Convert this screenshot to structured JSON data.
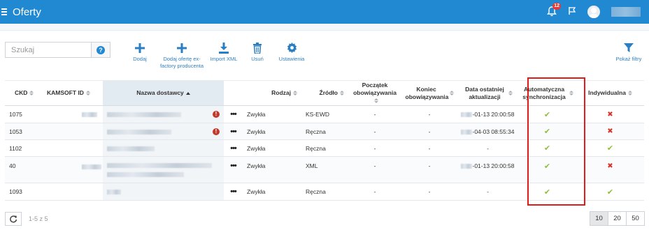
{
  "app": {
    "title": "Oferty",
    "notification_count": "12"
  },
  "search": {
    "placeholder": "Szukaj"
  },
  "toolbar": {
    "add": "Dodaj",
    "add_factory": "Dodaj ofertę ex-factory producenta",
    "import_xml": "Import XML",
    "delete": "Usuń",
    "settings": "Ustawienia",
    "show_filters": "Pokaż filtry"
  },
  "table": {
    "headers": {
      "ckd": "CKD",
      "kamsoft_id": "KAMSOFT ID",
      "supplier_name": "Nazwa dostawcy",
      "type": "Rodzaj",
      "source": "Źródło",
      "valid_from": "Początek obowiązywania",
      "valid_to": "Koniec obowiązywania",
      "last_update": "Data ostatniej aktualizacji",
      "auto_sync": "Automatyczna synchronizacja",
      "individual": "Indywidualna"
    },
    "rows": [
      {
        "ckd": "1075",
        "more": "•••",
        "type": "Zwykła",
        "source": "KS-EWD",
        "valid_from": "-",
        "valid_to": "-",
        "last_update": "-01-13 20:00:58",
        "auto_sync": "✔",
        "individual": "✖"
      },
      {
        "ckd": "1053",
        "more": "•••",
        "type": "Zwykła",
        "source": "Ręczna",
        "valid_from": "-",
        "valid_to": "-",
        "last_update": "-04-03 08:55:34",
        "auto_sync": "✔",
        "individual": "✖"
      },
      {
        "ckd": "1102",
        "more": "•••",
        "type": "Zwykła",
        "source": "Ręczna",
        "valid_from": "-",
        "valid_to": "-",
        "last_update": "-",
        "auto_sync": "✔",
        "individual": "✔"
      },
      {
        "ckd": "40",
        "more": "•••",
        "type": "Zwykła",
        "source": "XML",
        "valid_from": "-",
        "valid_to": "-",
        "last_update": "-01-13 20:00:58",
        "auto_sync": "✔",
        "individual": "✖"
      },
      {
        "ckd": "1093",
        "more": "•••",
        "type": "Zwykła",
        "source": "Ręczna",
        "valid_from": "-",
        "valid_to": "-",
        "last_update": "-",
        "auto_sync": "✔",
        "individual": "✔"
      }
    ]
  },
  "footer": {
    "pager_info": "1-5 z 5",
    "page_sizes": [
      "10",
      "20",
      "50"
    ],
    "active_page_size": "10"
  },
  "colors": {
    "primary": "#2189d2",
    "ok": "#8dbf3a",
    "error": "#d9332b",
    "highlight": "#e01b1b"
  }
}
